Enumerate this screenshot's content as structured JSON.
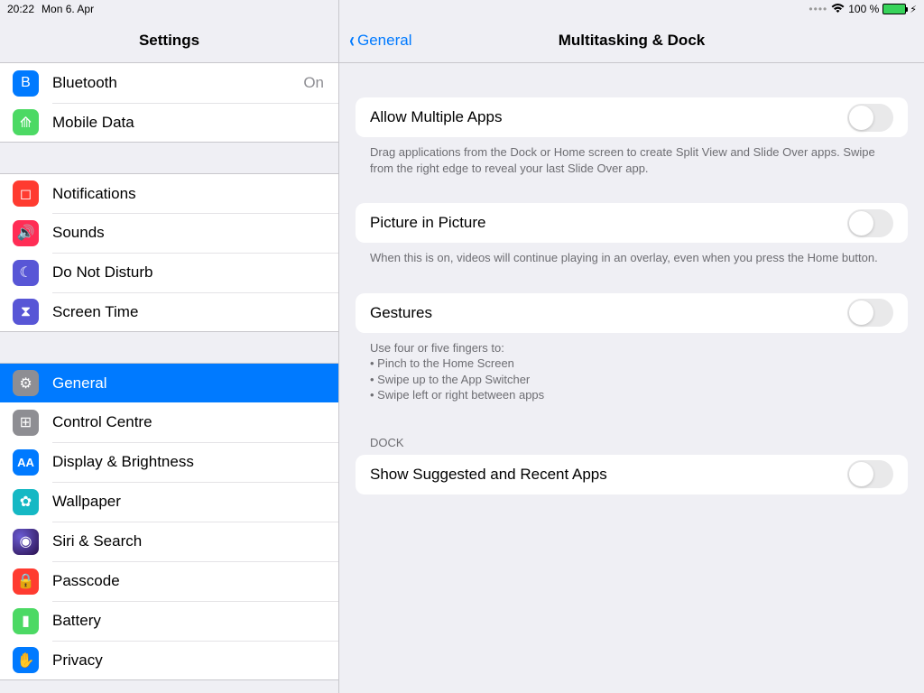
{
  "status": {
    "time": "20:22",
    "date": "Mon 6. Apr",
    "signal": "⋯⋅",
    "wifi": "􀙇",
    "battery_pct": "100 %"
  },
  "sidebar": {
    "title": "Settings",
    "group1": [
      {
        "name": "bluetooth",
        "label": "Bluetooth",
        "value": "On",
        "glyph": "B",
        "cls": "ic-bluetooth"
      },
      {
        "name": "mobile-data",
        "label": "Mobile Data",
        "value": "",
        "glyph": "⟰",
        "cls": "ic-mobile"
      }
    ],
    "group2": [
      {
        "name": "notifications",
        "label": "Notifications",
        "glyph": "◻",
        "cls": "ic-notif"
      },
      {
        "name": "sounds",
        "label": "Sounds",
        "glyph": "🔊",
        "cls": "ic-sounds"
      },
      {
        "name": "do-not-disturb",
        "label": "Do Not Disturb",
        "glyph": "☾",
        "cls": "ic-dnd"
      },
      {
        "name": "screen-time",
        "label": "Screen Time",
        "glyph": "⧗",
        "cls": "ic-screentime"
      }
    ],
    "group3": [
      {
        "name": "general",
        "label": "General",
        "glyph": "⚙",
        "cls": "ic-general",
        "selected": true
      },
      {
        "name": "control-centre",
        "label": "Control Centre",
        "glyph": "⊞",
        "cls": "ic-control"
      },
      {
        "name": "display-brightness",
        "label": "Display & Brightness",
        "glyph": "AA",
        "cls": "ic-display"
      },
      {
        "name": "wallpaper",
        "label": "Wallpaper",
        "glyph": "✿",
        "cls": "ic-wallpaper"
      },
      {
        "name": "siri-search",
        "label": "Siri & Search",
        "glyph": "◉",
        "cls": "ic-siri"
      },
      {
        "name": "passcode",
        "label": "Passcode",
        "glyph": "🔒",
        "cls": "ic-passcode"
      },
      {
        "name": "battery",
        "label": "Battery",
        "glyph": "▮",
        "cls": "ic-battery"
      },
      {
        "name": "privacy",
        "label": "Privacy",
        "glyph": "✋",
        "cls": "ic-privacy"
      }
    ]
  },
  "detail": {
    "back_label": "General",
    "title": "Multitasking & Dock",
    "allow_multiple": {
      "label": "Allow Multiple Apps",
      "footer": "Drag applications from the Dock or Home screen to create Split View and Slide Over apps. Swipe from the right edge to reveal your last Slide Over app."
    },
    "pip": {
      "label": "Picture in Picture",
      "footer": "When this is on, videos will continue playing in an overlay, even when you press the Home button."
    },
    "gestures": {
      "label": "Gestures",
      "footer_head": "Use four or five fingers to:",
      "footer_1": "• Pinch to the Home Screen",
      "footer_2": "• Swipe up to the App Switcher",
      "footer_3": "• Swipe left or right between apps"
    },
    "dock": {
      "header": "Dock",
      "row_label": "Show Suggested and Recent Apps"
    }
  }
}
